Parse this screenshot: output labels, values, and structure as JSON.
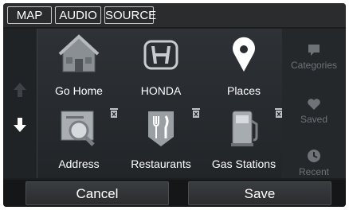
{
  "top_tabs": [
    {
      "label": "MAP"
    },
    {
      "label": "AUDIO"
    },
    {
      "label": "SOURCE"
    }
  ],
  "destinations": [
    {
      "label": "Go Home",
      "icon": "house-icon",
      "deletable": false
    },
    {
      "label": "HONDA",
      "icon": "honda-logo-icon",
      "deletable": false
    },
    {
      "label": "Places",
      "icon": "location-pin-icon",
      "deletable": false
    },
    {
      "label": "Address",
      "icon": "address-search-icon",
      "deletable": true
    },
    {
      "label": "Restaurants",
      "icon": "fork-knife-icon",
      "deletable": true
    },
    {
      "label": "Gas Stations",
      "icon": "gas-pump-icon",
      "deletable": true
    }
  ],
  "side_menu": [
    {
      "label": "Categories",
      "icon": "categories-icon"
    },
    {
      "label": "Saved",
      "icon": "heart-icon"
    },
    {
      "label": "Recent",
      "icon": "clock-icon"
    }
  ],
  "buttons": {
    "cancel": "Cancel",
    "save": "Save"
  },
  "colors": {
    "background": "#1b1d1f",
    "text": "#ffffff",
    "dimmed": "#6e7377",
    "icon_gray": "#9aa0a4"
  }
}
